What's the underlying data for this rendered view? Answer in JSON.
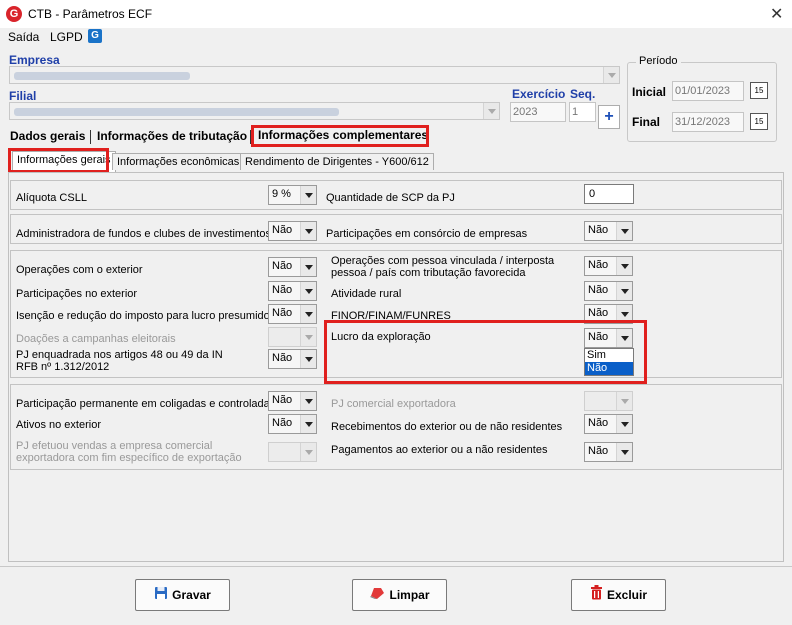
{
  "window": {
    "title": "CTB - Parâmetros ECF",
    "close_label": "✕"
  },
  "menu": {
    "items": [
      "Saída",
      "LGPD"
    ],
    "lgpd_icon": "G"
  },
  "empresa": {
    "label": "Empresa"
  },
  "filial": {
    "label": "Filial"
  },
  "exercicio": {
    "label": "Exercício",
    "value": "2023"
  },
  "seq": {
    "label": "Seq.",
    "value": "1"
  },
  "add_button": "+",
  "periodo": {
    "title": "Período",
    "inicial_label": "Inicial",
    "inicial_value": "01/01/2023",
    "final_label": "Final",
    "final_value": "31/12/2023",
    "calendar_label": "15"
  },
  "tabs": [
    "Dados gerais",
    "Informações de tributação",
    "Informações complementares"
  ],
  "subtabs": [
    "Informações gerais",
    "Informações econômicas",
    "Rendimento de Dirigentes - Y600/612"
  ],
  "fields": {
    "aliquota_csll": {
      "label": "Alíquota CSLL",
      "value": "9 %"
    },
    "qtd_scp": {
      "label": "Quantidade de SCP da PJ",
      "value": "0"
    },
    "adm_fundos": {
      "label": "Administradora de fundos e clubes de investimentos",
      "value": "Não"
    },
    "part_consorcio": {
      "label": "Participações em consórcio de empresas",
      "value": "Não"
    },
    "oper_exterior": {
      "label": "Operações com o exterior",
      "value": "Não"
    },
    "oper_pessoa_vinc": {
      "label": "Operações com pessoa vinculada / interposta pessoa / país com tributação favorecida",
      "value": "Não"
    },
    "part_exterior": {
      "label": "Participações no exterior",
      "value": "Não"
    },
    "ativ_rural": {
      "label": "Atividade rural",
      "value": "Não"
    },
    "isencao": {
      "label": "Isenção e redução do imposto para lucro presumido",
      "value": "Não"
    },
    "finor": {
      "label": "FINOR/FINAM/FUNRES",
      "value": "Não"
    },
    "doacoes": {
      "label": "Doações a campanhas eleitorais",
      "value": ""
    },
    "lucro_exploracao": {
      "label": "Lucro da exploração",
      "value": "Não"
    },
    "pj_enquadrada": {
      "label": "PJ enquadrada nos artigos 48 ou 49 da IN RFB nº 1.312/2012",
      "value": "Não"
    },
    "part_permanente": {
      "label": "Participação permanente em coligadas e controladas",
      "value": "Não"
    },
    "pj_comercial": {
      "label": "PJ comercial exportadora",
      "value": ""
    },
    "ativos_exterior": {
      "label": "Ativos no exterior",
      "value": "Não"
    },
    "receb_exterior": {
      "label": "Recebimentos do exterior ou de não residentes",
      "value": "Não"
    },
    "pj_vendas": {
      "label": "PJ efetuou vendas a empresa comercial exportadora com fim específico de exportação",
      "value": ""
    },
    "pagamentos_exterior": {
      "label": "Pagamentos ao exterior ou a não residentes",
      "value": "Não"
    }
  },
  "dropdown_options": [
    "Sim",
    "Não"
  ],
  "buttons": {
    "gravar": "Gravar",
    "limpar": "Limpar",
    "excluir": "Excluir"
  },
  "colors": {
    "highlight": "#e0201e",
    "label_blue": "#1f3fa8",
    "selection": "#0a5fc8"
  }
}
